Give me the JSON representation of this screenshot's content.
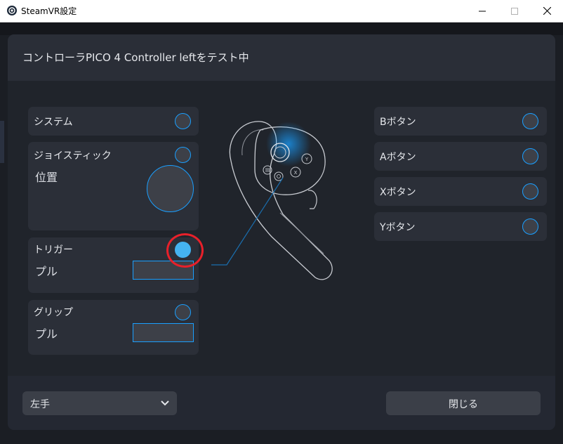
{
  "window": {
    "title": "SteamVR設定",
    "minimize_icon": "minimize-icon",
    "maximize_icon": "maximize-icon",
    "close_icon": "close-icon"
  },
  "dialog": {
    "title": "コントローラPICO 4 Controller leftをテスト中",
    "left_panels": {
      "system": {
        "label": "システム"
      },
      "joystick": {
        "label": "ジョイスティック",
        "sub": "位置"
      },
      "trigger": {
        "label": "トリガー",
        "sub": "プル",
        "pressed": true,
        "pull_fraction": 0
      },
      "grip": {
        "label": "グリップ",
        "sub": "プル",
        "pull_fraction": 0
      }
    },
    "right_buttons": [
      {
        "label": "Bボタン"
      },
      {
        "label": "Aボタン"
      },
      {
        "label": "Xボタン"
      },
      {
        "label": "Yボタン"
      }
    ],
    "footer": {
      "hand_select": {
        "value": "左手",
        "icon": "chevron-down-icon"
      },
      "close_label": "閉じる"
    }
  },
  "colors": {
    "accent": "#1a9fff",
    "active": "#45b3f0",
    "highlight_ring": "#e8202a",
    "panel": "#2b2f38",
    "dialog": "#242832"
  }
}
